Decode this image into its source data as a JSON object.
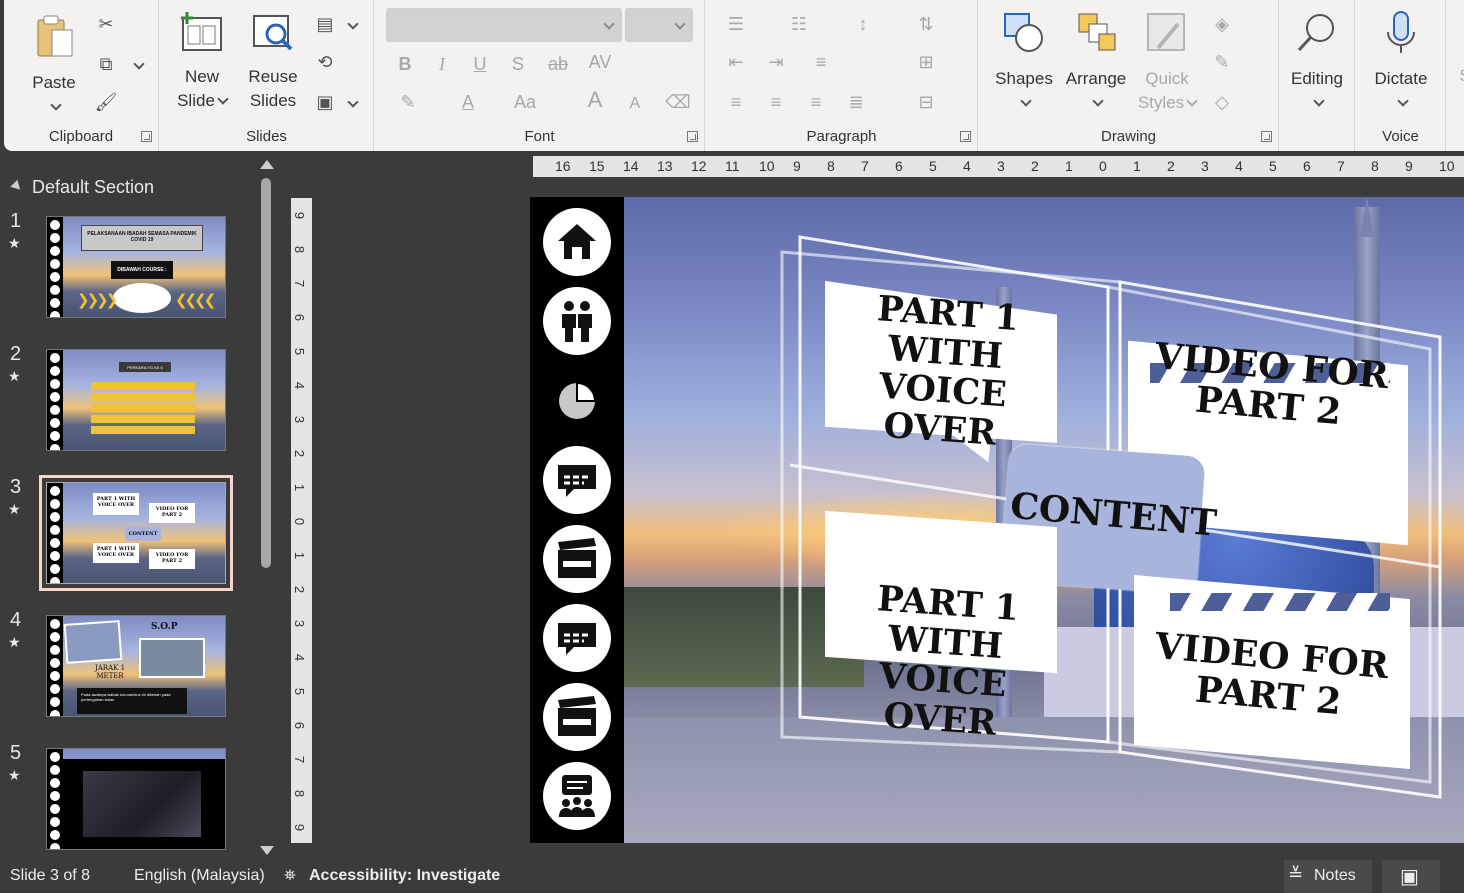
{
  "ribbon": {
    "clipboard": {
      "paste": "Paste",
      "group": "Clipboard"
    },
    "slides": {
      "new_slide_1": "New",
      "new_slide_2": "Slide",
      "reuse_1": "Reuse",
      "reuse_2": "Slides",
      "group": "Slides"
    },
    "font": {
      "group": "Font",
      "bold": "B",
      "italic": "I",
      "underline": "U",
      "strike": "S",
      "strike2": "ab",
      "spacing": "AV",
      "case": "Aa",
      "grow": "A",
      "shrink": "A"
    },
    "paragraph": {
      "group": "Paragraph"
    },
    "drawing": {
      "shapes": "Shapes",
      "arrange": "Arrange",
      "quick_1": "Quick",
      "quick_2": "Styles",
      "group": "Drawing"
    },
    "editing": {
      "label": "Editing"
    },
    "voice": {
      "dictate": "Dictate",
      "group": "Voice"
    },
    "cut_off": "S"
  },
  "thumbnails": {
    "section": "Default Section",
    "slides": [
      {
        "num": "1",
        "star": "★",
        "title": "PELAKSANAAN IBADAH SEMASA PANDEMIK COVID 19",
        "caption": "DIBAWAH COURSE :"
      },
      {
        "num": "2",
        "star": "★",
        "title": "PERKARA YG KE 6"
      },
      {
        "num": "3",
        "star": "★",
        "t1": "PART 1 WITH VOICE OVER",
        "t2": "VIDEO FOR PART 2",
        "t3": "CONTENT",
        "t4": "PART 1 WITH VOICE OVER",
        "t5": "VIDEO FOR PART 2"
      },
      {
        "num": "4",
        "star": "★",
        "t1": "S.O.P",
        "t2": "JARAK 1 METER",
        "t3": "Pada awalnya,wabak koronavirus ini dikesan pada pertengahan bulan"
      },
      {
        "num": "5",
        "star": "★"
      }
    ]
  },
  "h_ruler": [
    "16",
    "15",
    "14",
    "13",
    "12",
    "11",
    "10",
    "9",
    "8",
    "7",
    "6",
    "5",
    "4",
    "3",
    "2",
    "1",
    "0",
    "1",
    "2",
    "3",
    "4",
    "5",
    "6",
    "7",
    "8",
    "9",
    "10"
  ],
  "v_ruler": [
    "9",
    "8",
    "7",
    "6",
    "5",
    "4",
    "3",
    "2",
    "1",
    "0",
    "1",
    "2",
    "3",
    "4",
    "5",
    "6",
    "7",
    "8",
    "9"
  ],
  "slide": {
    "sign_tl": "PART 1 WITH VOICE OVER",
    "sign_tr": "VIDEO FOR PART 2",
    "center": "CONTENT",
    "sign_bl": "PART 1 WITH VOICE OVER",
    "sign_br": "VIDEO FOR PART 2",
    "nav_icons": [
      "home-icon",
      "people-icon",
      "pie-chart-icon",
      "chat-icon",
      "clapperboard-icon",
      "chat-icon",
      "clapperboard-icon",
      "presentation-group-icon"
    ]
  },
  "status": {
    "slide_of": "Slide 3 of 8",
    "language": "English (Malaysia)",
    "accessibility": "Accessibility: Investigate",
    "notes": "Notes"
  }
}
